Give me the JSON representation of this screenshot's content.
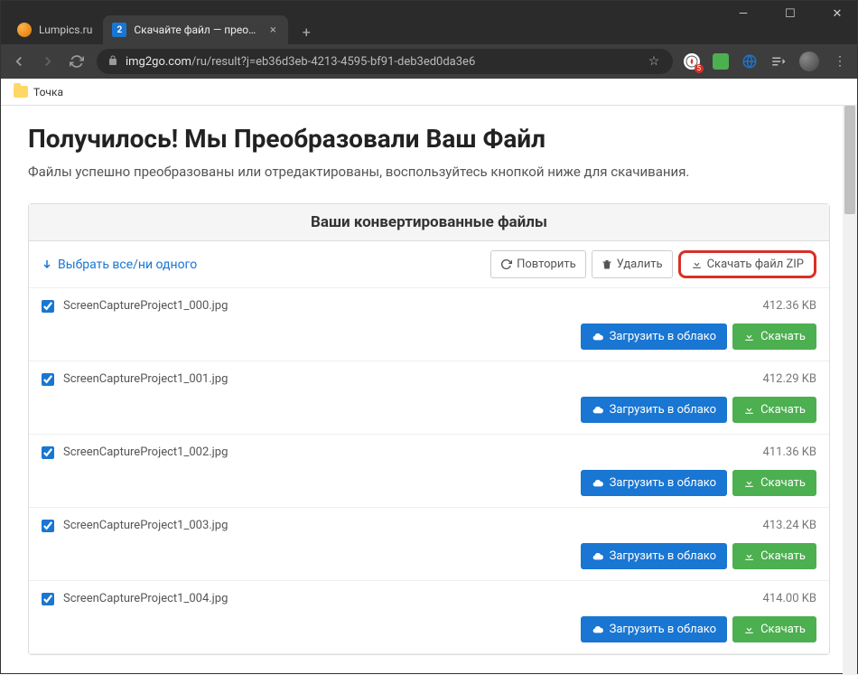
{
  "window": {
    "tabs": [
      {
        "title": "Lumpics.ru",
        "active": false
      },
      {
        "title": "Скачайте файл — преобразов",
        "active": true,
        "favicon_text": "2"
      }
    ]
  },
  "toolbar": {
    "url_domain": "img2go.com",
    "url_path": "/ru/result?j=eb36d3eb-4213-4595-bf91-deb3ed0da3e6",
    "ext_badge": "5"
  },
  "bookmarks": {
    "item1": "Точка"
  },
  "page": {
    "title": "Получилось! Мы Преобразовали Ваш Файл",
    "subtitle": "Файлы успешно преобразованы или отредактированы, воспользуйтесь кнопкой ниже для скачивания."
  },
  "panel": {
    "header": "Ваши конвертированные файлы",
    "select_all": "Выбрать все/ни одного",
    "repeat": "Повторить",
    "delete": "Удалить",
    "download_zip": "Скачать файл ZIP",
    "upload_cloud": "Загрузить в облако",
    "download": "Скачать"
  },
  "files": [
    {
      "name": "ScreenCaptureProject1_000.jpg",
      "size": "412.36 KB"
    },
    {
      "name": "ScreenCaptureProject1_001.jpg",
      "size": "412.29 KB"
    },
    {
      "name": "ScreenCaptureProject1_002.jpg",
      "size": "411.36 KB"
    },
    {
      "name": "ScreenCaptureProject1_003.jpg",
      "size": "413.24 KB"
    },
    {
      "name": "ScreenCaptureProject1_004.jpg",
      "size": "414.00 KB"
    }
  ]
}
